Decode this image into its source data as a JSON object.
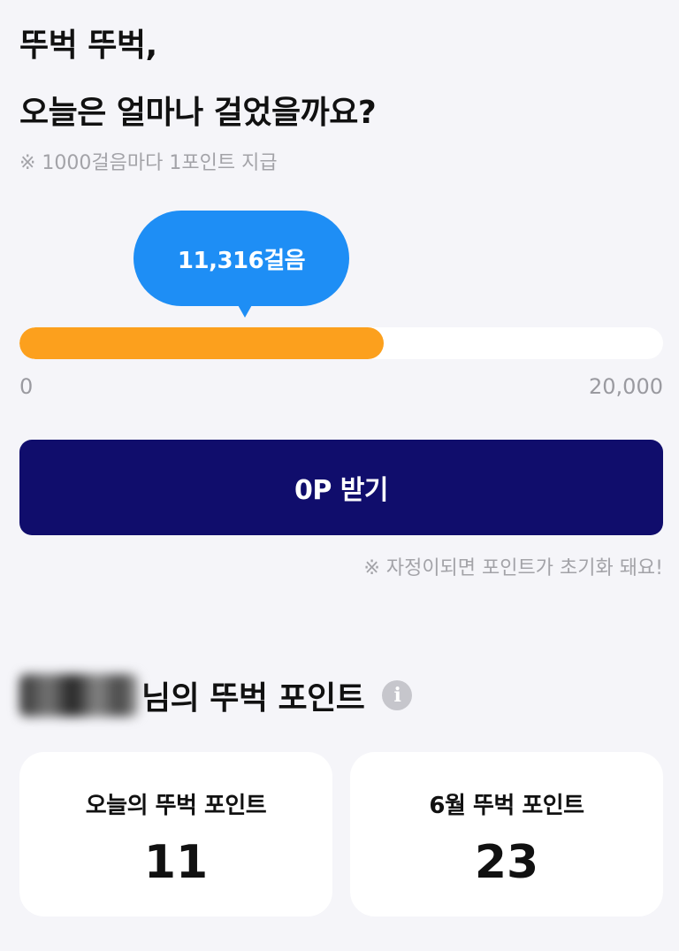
{
  "header": {
    "title_line1": "뚜벅 뚜벅,",
    "title_line2": "오늘은 얼마나 걸었을까요?",
    "notice": "※ 1000걸음마다 1포인트 지급"
  },
  "steps": {
    "bubble_text": "11,316걸음",
    "current": 11316,
    "progress_fraction": 0.5658,
    "range_min_label": "0",
    "range_max_label": "20,000"
  },
  "claim": {
    "button_label": "0P 받기",
    "reset_notice": "※ 자정이되면 포인트가 초기화 돼요!"
  },
  "points_section": {
    "title_suffix": "님의 뚜벅 포인트",
    "info_icon": "info-icon",
    "today": {
      "label": "오늘의 뚜벅 포인트",
      "value": "11"
    },
    "month": {
      "label": "6월 뚜벅 포인트",
      "value": "23"
    }
  },
  "colors": {
    "background": "#f5f5f9",
    "bubble": "#1e8ef5",
    "progress_fill": "#fca01d",
    "track": "#ffffff",
    "button": "#100d6c",
    "muted_text": "#a3a3a8"
  }
}
